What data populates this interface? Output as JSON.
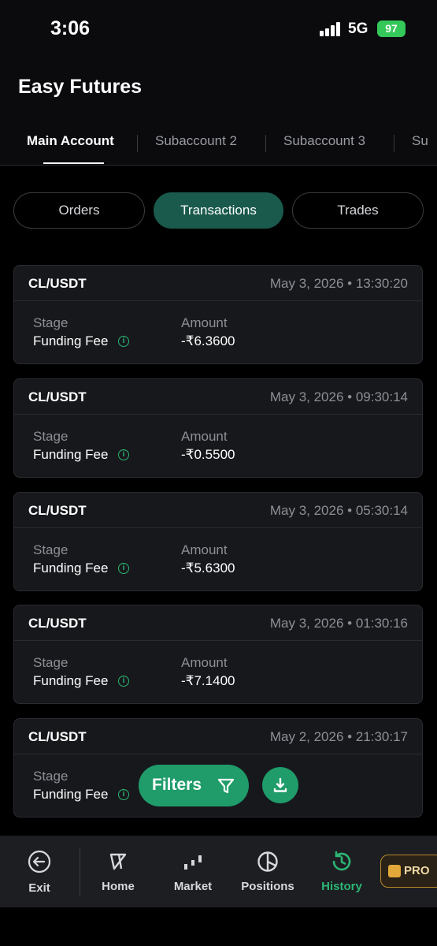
{
  "status_bar": {
    "time": "3:06",
    "network": "5G",
    "battery": "97"
  },
  "app": {
    "title": "Easy Futures"
  },
  "account_tabs": [
    "Main Account",
    "Subaccount 2",
    "Subaccount 3",
    "Su"
  ],
  "segments": [
    "Orders",
    "Transactions",
    "Trades"
  ],
  "labels": {
    "stage": "Stage",
    "amount": "Amount"
  },
  "transactions": [
    {
      "pair": "CL/USDT",
      "datetime": "May 3, 2026 • 13:30:20",
      "stage": "Funding Fee",
      "amount": "-₹6.3600"
    },
    {
      "pair": "CL/USDT",
      "datetime": "May 3, 2026 • 09:30:14",
      "stage": "Funding Fee",
      "amount": "-₹0.5500"
    },
    {
      "pair": "CL/USDT",
      "datetime": "May 3, 2026 • 05:30:14",
      "stage": "Funding Fee",
      "amount": "-₹5.6300"
    },
    {
      "pair": "CL/USDT",
      "datetime": "May 3, 2026 • 01:30:16",
      "stage": "Funding Fee",
      "amount": "-₹7.1400"
    },
    {
      "pair": "CL/USDT",
      "datetime": "May 2, 2026 • 21:30:17",
      "stage": "Funding Fee",
      "amount": ""
    }
  ],
  "filters_button": {
    "label": "Filters"
  },
  "bottom_nav": {
    "exit": "Exit",
    "home": "Home",
    "market": "Market",
    "positions": "Positions",
    "history": "History",
    "pro": "PRO"
  },
  "colors": {
    "accent": "#1f9c6a",
    "active_segment": "#1a5a4c",
    "active_nav": "#2bb673"
  }
}
